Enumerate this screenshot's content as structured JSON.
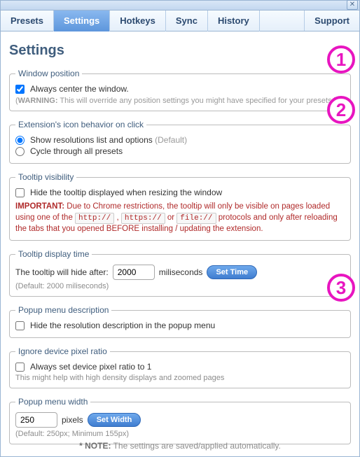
{
  "tabs": {
    "presets": "Presets",
    "settings": "Settings",
    "hotkeys": "Hotkeys",
    "sync": "Sync",
    "history": "History",
    "support": "Support"
  },
  "page_title": "Settings",
  "fs_window_pos": {
    "legend": "Window position",
    "checkbox_label": "Always center the window.",
    "warning_label": "WARNING:",
    "warning_text": " This will override any position settings you might have specified for your presets."
  },
  "fs_icon_behavior": {
    "legend": "Extension's icon behavior on click",
    "opt1": "Show resolutions list and options",
    "opt1_suffix": " (Default)",
    "opt2": "Cycle through all presets"
  },
  "fs_tooltip_vis": {
    "legend": "Tooltip visibility",
    "checkbox_label": "Hide the tooltip displayed when resizing the window",
    "important_label": "IMPORTANT:",
    "important_p1": " Due to Chrome restrictions, the tooltip will only be visible on pages loaded using one of the ",
    "proto1": "http://",
    "sep1": " , ",
    "proto2": "https://",
    "sep2": " or ",
    "proto3": "file://",
    "important_p2": " protocols and only after reloading the tabs that you opened BEFORE installing / updating the extension."
  },
  "fs_tooltip_time": {
    "legend": "Tooltip display time",
    "before": "The tooltip will hide after:",
    "value": "2000",
    "after": "miliseconds",
    "button": "Set Time",
    "default": "(Default: 2000 miliseconds)"
  },
  "fs_popup_desc": {
    "legend": "Popup menu description",
    "checkbox_label": "Hide the resolution description in the popup menu"
  },
  "fs_dpr": {
    "legend": "Ignore device pixel ratio",
    "checkbox_label": "Always set device pixel ratio to 1",
    "helper": "This might help with high density displays and zoomed pages"
  },
  "fs_popup_width": {
    "legend": "Popup menu width",
    "value": "250",
    "after": "pixels",
    "button": "Set Width",
    "default": "(Default: 250px; Minimum 155px)"
  },
  "footer": {
    "label": "* NOTE:",
    "text": " The settings are saved/applied automatically."
  },
  "annotations": {
    "a1": "1",
    "a2": "2",
    "a3": "3"
  }
}
